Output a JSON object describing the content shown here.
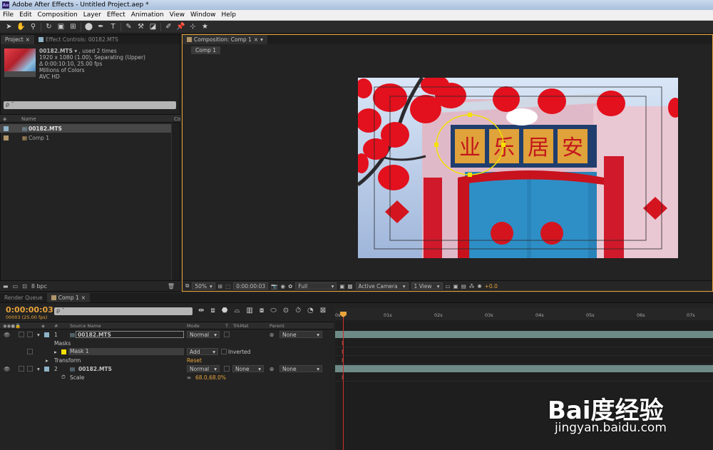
{
  "window": {
    "title": "Adobe After Effects - Untitled Project.aep *",
    "app_icon": "Ae"
  },
  "menu": [
    "File",
    "Edit",
    "Composition",
    "Layer",
    "Effect",
    "Animation",
    "View",
    "Window",
    "Help"
  ],
  "project_panel": {
    "tab_project": "Project",
    "tab_effect_controls": "Effect Controls: 00182.MTS",
    "selected_name": "00182.MTS",
    "selected_used": "▾ , used 2 times",
    "info_line1": "1920 x 1080 (1.00), Separating (Upper)",
    "info_line2": "Δ 0:00:10:10, 25.00 fps",
    "info_line3": "Millions of Colors",
    "info_line4": "AVC HD",
    "search_placeholder": "ρ ¯",
    "col_name": "Name",
    "col_co": "Co",
    "items": [
      {
        "name": "00182.MTS",
        "color": "#8fb3c8"
      },
      {
        "name": "Comp 1",
        "color": "#b0966a"
      }
    ],
    "bpc": "8 bpc"
  },
  "composition_panel": {
    "tab": "Composition: Comp 1",
    "sub_tab": "Comp 1",
    "footer": {
      "zoom": "50%",
      "timecode": "0:00:00:03",
      "resolution": "Full",
      "camera": "Active Camera",
      "view": "1 View",
      "exposure": "+0.0"
    },
    "scene_text": "业乐居安"
  },
  "timeline": {
    "tab_render": "Render Queue",
    "tab_comp": "Comp 1",
    "timecode": "0:00:00:03",
    "timecode_sub": "00003 (25.00 fps)",
    "search_placeholder": "ρ ¯",
    "headers": {
      "num": "#",
      "source": "Source Name",
      "mode": "Mode",
      "t": "T",
      "trkmat": "TrkMat",
      "parent": "Parent"
    },
    "layers": [
      {
        "num": "1",
        "name": "00182.MTS",
        "mode": "Normal",
        "parent": "None",
        "trkmat": ""
      },
      {
        "num": "2",
        "name": "00182.MTS",
        "mode": "Normal",
        "parent": "None",
        "trkmat": "None"
      }
    ],
    "masks_label": "Masks",
    "mask_name": "Mask 1",
    "mask_mode": "Add",
    "mask_inverted": "Inverted",
    "transform_label": "Transform",
    "transform_reset": "Reset",
    "scale_label": "Scale",
    "scale_value": "68.0,68.0%",
    "ruler": [
      "0s",
      "01s",
      "02s",
      "03s",
      "04s",
      "05s",
      "06s",
      "07s"
    ]
  },
  "watermark": {
    "logo": "Bai度经验",
    "url": "jingyan.baidu.com"
  }
}
